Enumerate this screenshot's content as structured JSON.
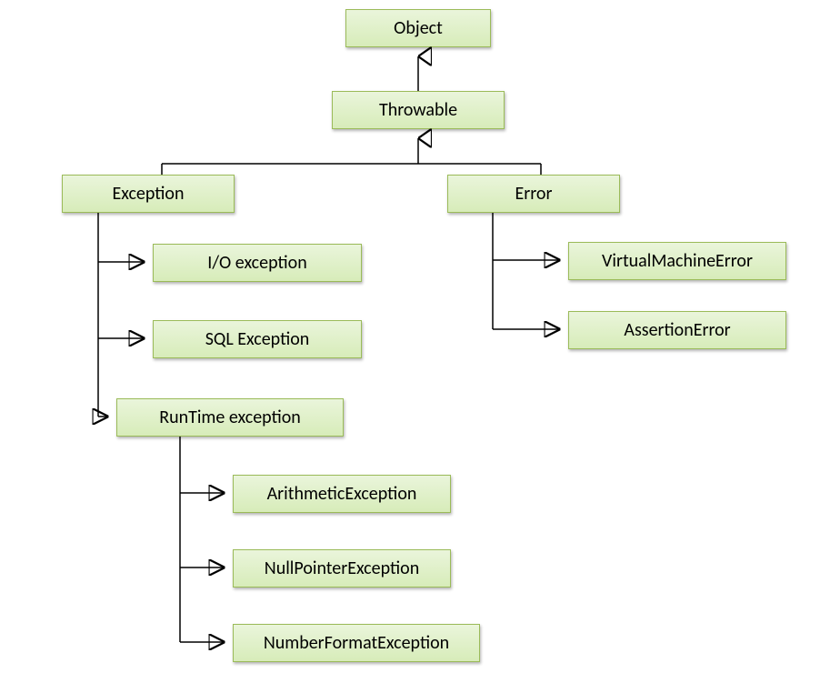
{
  "nodes": {
    "object": "Object",
    "throwable": "Throwable",
    "exception": "Exception",
    "error": "Error",
    "io_exception": "I/O exception",
    "sql_exception": "SQL Exception",
    "runtime_exception": "RunTime exception",
    "virtual_machine_error": "VirtualMachineError",
    "assertion_error": "AssertionError",
    "arithmetic_exception": "ArithmeticException",
    "null_pointer_exception": "NullPointerException",
    "number_format_exception": "NumberFormatException"
  }
}
